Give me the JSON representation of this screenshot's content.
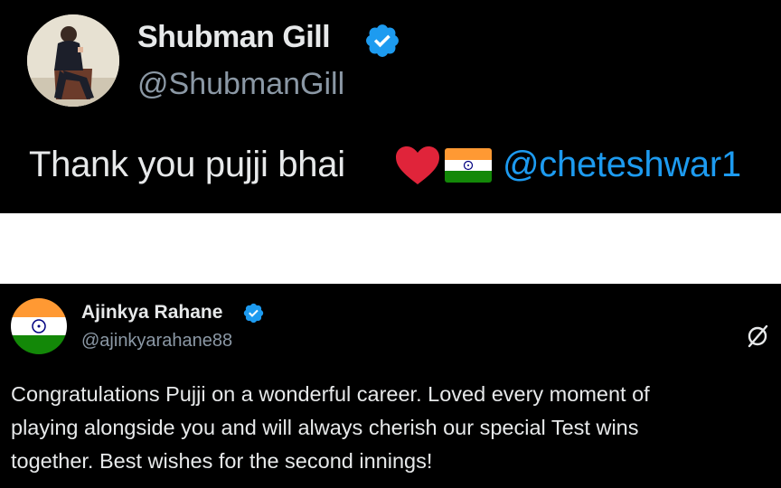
{
  "tweet_1": {
    "display_name": "Shubman Gill",
    "handle": "@ShubmanGill",
    "text": "Thank you pujji bhai",
    "mention": "@cheteshwar1",
    "emoji": [
      "red-heart-icon",
      "india-flag-icon"
    ]
  },
  "tweet_2": {
    "display_name": "Ajinkya Rahane",
    "handle": "@ajinkyarahane88",
    "body_lines": [
      "Congratulations Pujji on a wonderful career. Loved every moment of",
      "playing alongside you and will always cherish our special Test wins",
      "together. Best wishes for the second innings!"
    ]
  },
  "colors": {
    "background": "#000000",
    "text": "#e7e9ea",
    "muted": "#8b98a5",
    "accent": "#1d9bf0",
    "verified": "#1d9bf0"
  }
}
